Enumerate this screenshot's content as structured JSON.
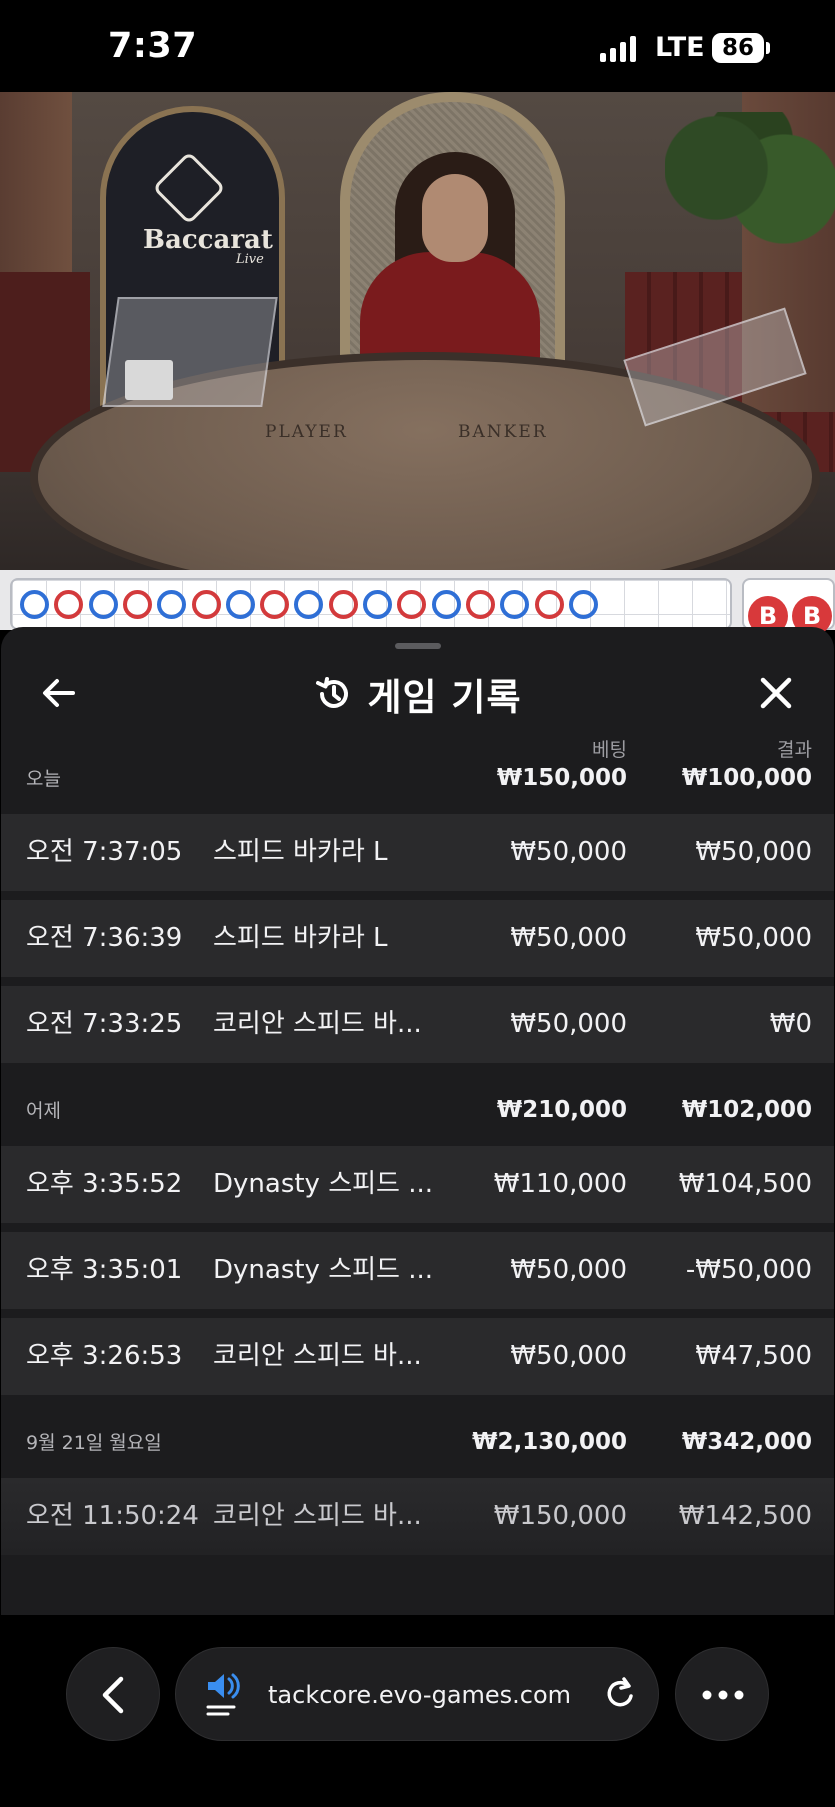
{
  "status": {
    "time": "7:37",
    "network": "LTE",
    "battery": "86"
  },
  "video": {
    "logo_text": "Baccarat",
    "logo_sub": "Live",
    "table_player": "PLAYER",
    "table_banker": "BANKER"
  },
  "roadmap": {
    "beads": [
      "blue",
      "red",
      "blue",
      "red",
      "blue",
      "red",
      "blue",
      "red",
      "blue",
      "red",
      "blue",
      "red",
      "blue",
      "red",
      "blue",
      "red",
      "blue"
    ],
    "side_badges": [
      "B",
      "B"
    ]
  },
  "sheet": {
    "title": "게임 기록",
    "col_bet": "베팅",
    "col_result": "결과",
    "groups": [
      {
        "label": "오늘",
        "bet_total": "₩150,000",
        "result_total": "₩100,000",
        "rows": [
          {
            "time": "오전 7:37:05",
            "game": "스피드 바카라 L",
            "bet": "₩50,000",
            "result": "₩50,000"
          },
          {
            "time": "오전 7:36:39",
            "game": "스피드 바카라 L",
            "bet": "₩50,000",
            "result": "₩50,000"
          },
          {
            "time": "오전 7:33:25",
            "game": "코리안 스피드 바...",
            "bet": "₩50,000",
            "result": "₩0"
          }
        ]
      },
      {
        "label": "어제",
        "bet_total": "₩210,000",
        "result_total": "₩102,000",
        "rows": [
          {
            "time": "오후 3:35:52",
            "game": "Dynasty 스피드 ...",
            "bet": "₩110,000",
            "result": "₩104,500"
          },
          {
            "time": "오후 3:35:01",
            "game": "Dynasty 스피드 ...",
            "bet": "₩50,000",
            "result": "-₩50,000"
          },
          {
            "time": "오후 3:26:53",
            "game": "코리안 스피드 바...",
            "bet": "₩50,000",
            "result": "₩47,500"
          }
        ]
      },
      {
        "label": "9월 21일 월요일",
        "bet_total": "₩2,130,000",
        "result_total": "₩342,000",
        "rows": [
          {
            "time": "오전 11:50:24",
            "game": "코리안 스피드 바...",
            "bet": "₩150,000",
            "result": "₩142,500"
          }
        ]
      }
    ]
  },
  "browser": {
    "url": "tackcore.evo-games.com"
  },
  "icons": {
    "back": "arrow-left-icon",
    "close": "close-icon",
    "history": "history-icon",
    "browser_back": "chevron-left-icon",
    "speaker": "speaker-icon",
    "reload": "reload-icon",
    "more": "more-icon"
  },
  "colors": {
    "sheet_bg": "#1c1c1e",
    "row_bg": "#2a2a2c",
    "player_blue": "#2f6fd6",
    "banker_red": "#d33a3c"
  }
}
